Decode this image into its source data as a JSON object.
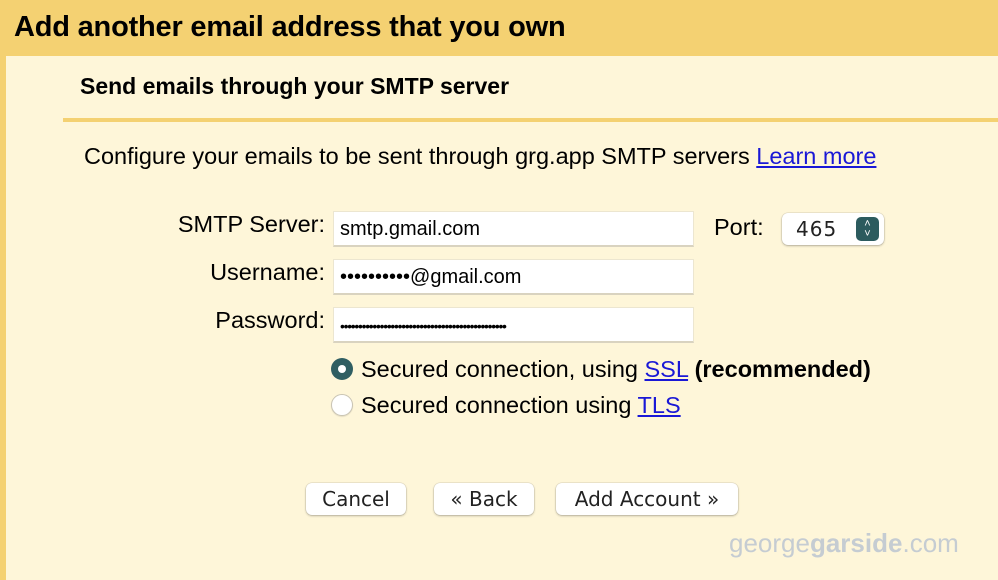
{
  "dialog": {
    "title": "Add another email address that you own",
    "subtitle": "Send emails through your SMTP server",
    "description": "Configure your emails to be sent through grg.app SMTP servers",
    "learn_more": "Learn more"
  },
  "form": {
    "smtp_server_label": "SMTP Server:",
    "smtp_server_value": "smtp.gmail.com",
    "port_label": "Port:",
    "port_value": "465",
    "username_label": "Username:",
    "username_value": "••••••••••@gmail.com",
    "password_label": "Password:",
    "password_value": "••••••••••••••••••••••••••••••••••••••••••••••"
  },
  "security": {
    "ssl_prefix": "Secured connection, using",
    "ssl_link": "SSL",
    "ssl_suffix": "(recommended)",
    "ssl_selected": true,
    "tls_prefix": "Secured connection using",
    "tls_link": "TLS",
    "tls_selected": false
  },
  "buttons": {
    "cancel": "Cancel",
    "back": "« Back",
    "add_account": "Add Account »"
  },
  "watermark": {
    "part1": "george",
    "part2": "garside",
    "part3": ".com"
  },
  "colors": {
    "frame": "#f4d172",
    "background": "#fef6d9",
    "link": "#1a18d6",
    "radio_selected": "#2f5e62"
  }
}
